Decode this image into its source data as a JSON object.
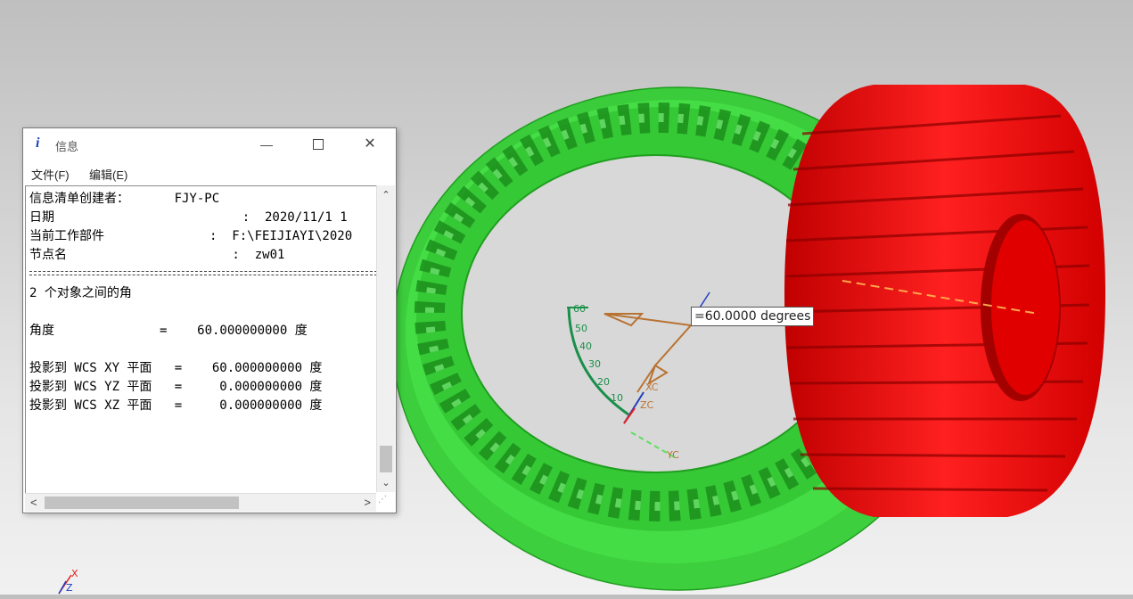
{
  "info_window": {
    "icon_glyph": "i",
    "title": "信息",
    "controls": {
      "minimize": "—",
      "close": "✕"
    },
    "menu": [
      {
        "label": "文件(F)"
      },
      {
        "label": "编辑(E)"
      }
    ],
    "lines": [
      "信息清单创建者：      FJY-PC",
      "日期                         :  2020/11/1 1",
      "当前工作部件              :  F:\\FEIJIAYI\\2020",
      "节点名                      :  zw01",
      "",
      "2 个对象之间的角",
      "",
      "角度              =    60.000000000 度",
      "",
      "投影到 WCS XY 平面   =    60.000000000 度",
      "投影到 WCS YZ 平面   =     0.000000000 度",
      "投影到 WCS XZ 平面   =     0.000000000 度"
    ],
    "scroll": {
      "up": "⌃",
      "down": "⌄",
      "left": "<",
      "right": ">"
    }
  },
  "viewport": {
    "measurement_label": "=60.0000 degrees",
    "protractor_ticks": [
      "60",
      "50",
      "40",
      "30",
      "20",
      "10"
    ],
    "csys_labels": {
      "xc": "XC",
      "zc": "ZC",
      "yc": "YC"
    },
    "triad_labels": {
      "x": "X",
      "z": "Z"
    },
    "colors": {
      "ring_gear": "#39d339",
      "ring_gear_dark": "#1f9e1f",
      "spur_gear": "#ff1414",
      "spur_gear_dark": "#b80000",
      "measure_lines": "#b87333",
      "protractor": "#1a8f4a"
    }
  }
}
